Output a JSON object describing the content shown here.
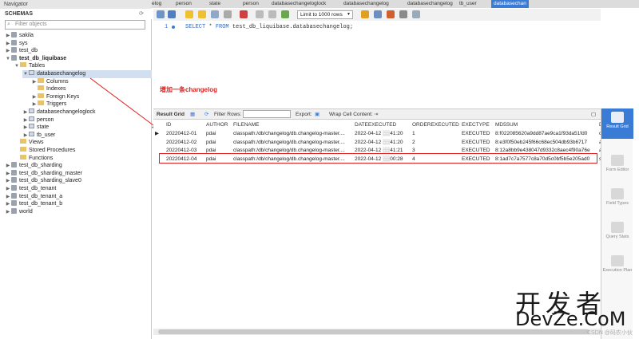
{
  "navigator": {
    "title": "Navigator",
    "schemas_header": "SCHEMAS",
    "filter_placeholder": "Filter objects",
    "tree": [
      {
        "label": "sakila",
        "level": 0,
        "twisty": "▶",
        "icon": "db"
      },
      {
        "label": "sys",
        "level": 0,
        "twisty": "▶",
        "icon": "db"
      },
      {
        "label": "test_db",
        "level": 0,
        "twisty": "▶",
        "icon": "db"
      },
      {
        "label": "test_db_liquibase",
        "level": 0,
        "twisty": "▼",
        "icon": "db",
        "bold": true
      },
      {
        "label": "Tables",
        "level": 1,
        "twisty": "▼",
        "icon": "folder"
      },
      {
        "label": "databasechangelog",
        "level": 2,
        "twisty": "▼",
        "icon": "table",
        "selected": true
      },
      {
        "label": "Columns",
        "level": 3,
        "twisty": "▶",
        "icon": "folder"
      },
      {
        "label": "Indexes",
        "level": 3,
        "twisty": "",
        "icon": "folder"
      },
      {
        "label": "Foreign Keys",
        "level": 3,
        "twisty": "▶",
        "icon": "folder"
      },
      {
        "label": "Triggers",
        "level": 3,
        "twisty": "▶",
        "icon": "folder"
      },
      {
        "label": "databasechangeloglock",
        "level": 2,
        "twisty": "▶",
        "icon": "table"
      },
      {
        "label": "person",
        "level": 2,
        "twisty": "▶",
        "icon": "table"
      },
      {
        "label": "state",
        "level": 2,
        "twisty": "▶",
        "icon": "table"
      },
      {
        "label": "tb_user",
        "level": 2,
        "twisty": "▶",
        "icon": "table"
      },
      {
        "label": "Views",
        "level": 1,
        "twisty": "",
        "icon": "folder"
      },
      {
        "label": "Stored Procedures",
        "level": 1,
        "twisty": "",
        "icon": "folder"
      },
      {
        "label": "Functions",
        "level": 1,
        "twisty": "",
        "icon": "folder"
      },
      {
        "label": "test_db_sharding",
        "level": 0,
        "twisty": "▶",
        "icon": "db"
      },
      {
        "label": "test_db_sharding_master",
        "level": 0,
        "twisty": "▶",
        "icon": "db"
      },
      {
        "label": "test_db_sharding_slave0",
        "level": 0,
        "twisty": "▶",
        "icon": "db"
      },
      {
        "label": "test_db_tenant",
        "level": 0,
        "twisty": "▶",
        "icon": "db"
      },
      {
        "label": "test_db_tenant_a",
        "level": 0,
        "twisty": "▶",
        "icon": "db"
      },
      {
        "label": "test_db_tenant_b",
        "level": 0,
        "twisty": "▶",
        "icon": "db"
      },
      {
        "label": "world",
        "level": 0,
        "twisty": "▶",
        "icon": "db"
      }
    ]
  },
  "tabs": [
    "elog",
    "person",
    "state",
    "person",
    "databasechangeloglock",
    "databasechangelog",
    "databasechangelog",
    "tb_user",
    "databasechan"
  ],
  "toolbar": {
    "limit_label": "Limit to 1000 rows"
  },
  "editor": {
    "line_number": "1",
    "sql_kw1": "SELECT",
    "sql_mid": " * ",
    "sql_kw2": "FROM",
    "sql_rest": " test_db_liquibase.databasechangelog;"
  },
  "annotation": "增加一条changelog",
  "result_toolbar": {
    "result_grid": "Result Grid",
    "filter_rows": "Filter Rows:",
    "export": "Export:",
    "wrap": "Wrap Cell Content:"
  },
  "grid": {
    "columns": [
      "ID",
      "AUTHOR",
      "FILENAME",
      "DATEEXECUTED",
      "ORDEREXECUTED",
      "EXECTYPE",
      "MD5SUM",
      "D"
    ],
    "rows": [
      [
        "20220412-01",
        "pdai",
        "classpath:/db/changelog/db.changelog-master....",
        "2022-04-12 ░░41:20",
        "1",
        "EXECUTED",
        "8:f022085620a9dd87ae9ca1f93da51fd0",
        "cr"
      ],
      [
        "20220412-02",
        "pdai",
        "classpath:/db/changelog/db.changelog-master....",
        "2022-04-12 ░░41:20",
        "2",
        "EXECUTED",
        "8:e3f0f50eb245f66c68ec504db93b6717",
        "ac"
      ],
      [
        "20220412-03",
        "pdai",
        "classpath:/db/changelog/db.changelog-master....",
        "2022-04-12 ░░41:21",
        "3",
        "EXECUTED",
        "8:12a8bb9e438047d9332c8aec4f90a76e",
        "ac"
      ],
      [
        "20220412-04",
        "pdai",
        "classpath:/db/changelog/db.changelog-master....",
        "2022-04-12 ░░00:28",
        "4",
        "EXECUTED",
        "8:1ad7c7a7577c8a70d5c0bf5b5e205ad0",
        "sc"
      ]
    ]
  },
  "right_panel": [
    {
      "label": "Result Grid",
      "active": true
    },
    {
      "label": "Form Editor",
      "active": false
    },
    {
      "label": "Field Types",
      "active": false
    },
    {
      "label": "Query Stats",
      "active": false
    },
    {
      "label": "Execution Plan",
      "active": false
    }
  ],
  "watermark": {
    "line1": "开发者",
    "line2": "DevZe.CoM",
    "line3": "CSDN @码农小伙"
  }
}
